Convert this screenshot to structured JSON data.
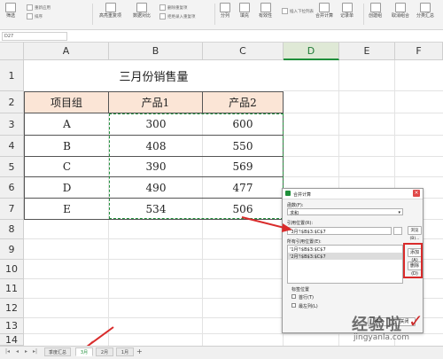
{
  "ribbon": {
    "filter_label": "筛选",
    "reapply_label": "重新应用",
    "sort_label": "排序",
    "highlight_dup_label": "高亮重复项",
    "data_compare_label": "数据对比",
    "remove_dup_label": "删除重复项",
    "reject_dup_label": "拒绝录入重复项",
    "split_label": "分列",
    "fill_label": "填充",
    "validity_label": "有效性",
    "dropdown_label": "插入下拉列表",
    "merge_calc_label": "合并计算",
    "record_label": "记录单",
    "group_label": "创建组",
    "ungroup_label": "取消组合",
    "subtotal_label": "分类汇总"
  },
  "formula_bar": {
    "name_box": "D27"
  },
  "columns": [
    "A",
    "B",
    "C",
    "D",
    "E",
    "F"
  ],
  "rows": [
    "1",
    "2",
    "3",
    "4",
    "5",
    "6",
    "7",
    "8",
    "9",
    "10",
    "11",
    "12",
    "13",
    "14"
  ],
  "sheet": {
    "title": "三月份销售量",
    "headers": [
      "项目组",
      "产品1",
      "产品2"
    ],
    "data": [
      [
        "A",
        "300",
        "600"
      ],
      [
        "B",
        "408",
        "550"
      ],
      [
        "C",
        "390",
        "569"
      ],
      [
        "D",
        "490",
        "477"
      ],
      [
        "E",
        "534",
        "506"
      ]
    ]
  },
  "dialog": {
    "title": "合并计算",
    "function_label": "函数(F):",
    "function_value": "求和",
    "ref_label": "引用位置(R):",
    "ref_value": "'3月'!$B$3:$C$7",
    "browse_button": "浏览(B)...",
    "all_refs_label": "所有引用位置(E):",
    "all_refs": [
      "'1月'!$B$3:$C$7",
      "'2月'!$B$3:$C$7"
    ],
    "add_button": "添加(A)",
    "delete_button": "删除(D)",
    "label_pos": "标签位置",
    "first_row": "首行(T)",
    "left_col": "最左列(L)",
    "ok_button": "确定",
    "cancel_button": "关闭"
  },
  "tabs": [
    "季度汇总",
    "3月",
    "2月",
    "1月"
  ],
  "active_tab": "3月",
  "add_tab_label": "+",
  "watermark": {
    "line1": "经验啦",
    "line2": "jingyanla.com"
  },
  "colors": {
    "accent": "#1f8f3a",
    "header_fill": "#fbe5d6",
    "annotation": "#d92b2b"
  }
}
